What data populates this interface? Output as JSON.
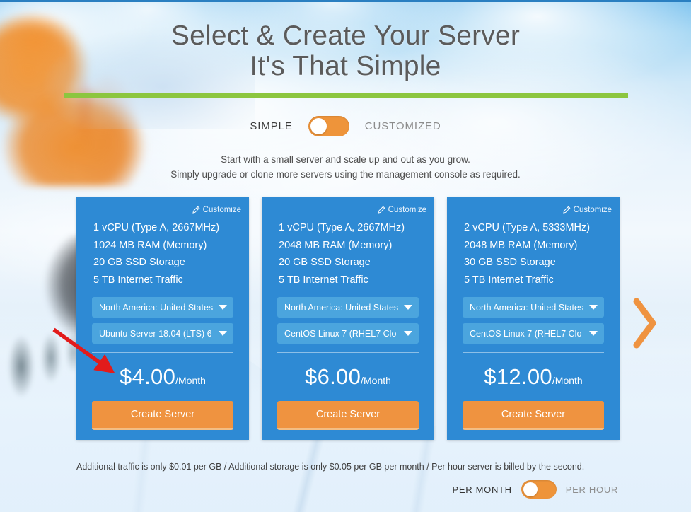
{
  "page": {
    "headline_line1": "Select & Create Your Server",
    "headline_line2": "It's That Simple",
    "subcopy_line1": "Start with a small server and scale up and out as you grow.",
    "subcopy_line2": "Simply upgrade or clone more servers using the management console as required.",
    "footnote": "Additional traffic is only $0.01 per GB / Additional storage is only $0.05 per GB per month / Per hour server is billed by the second.",
    "accent_green": "#8cc63f",
    "accent_orange": "#ef9340",
    "card_blue": "#2e8ad4",
    "select_blue": "#4ba5de",
    "annotation_red": "#e21b1b"
  },
  "mode_toggle": {
    "left_label": "SIMPLE",
    "right_label": "CUSTOMIZED",
    "selected": "SIMPLE",
    "knob_position": "left"
  },
  "billing_toggle": {
    "left_label": "PER MONTH",
    "right_label": "PER HOUR",
    "selected": "PER MONTH",
    "knob_position": "left"
  },
  "nav": {
    "next_label": "next",
    "next_icon": "chevron-right-icon"
  },
  "cards": [
    {
      "customize_label": "Customize",
      "customize_icon": "pencil-icon",
      "specs": [
        "1 vCPU (Type A, 2667MHz)",
        "1024 MB RAM (Memory)",
        "20 GB SSD Storage",
        "5 TB Internet Traffic"
      ],
      "region_select": "North America: United States",
      "os_select": "Ubuntu Server 18.04 (LTS) 6",
      "price_amount": "$4.00",
      "price_period": "/Month",
      "cta_label": "Create Server"
    },
    {
      "customize_label": "Customize",
      "customize_icon": "pencil-icon",
      "specs": [
        "1 vCPU (Type A, 2667MHz)",
        "2048 MB RAM (Memory)",
        "20 GB SSD Storage",
        "5 TB Internet Traffic"
      ],
      "region_select": "North America: United States",
      "os_select": "CentOS Linux 7 (RHEL7 Clo",
      "price_amount": "$6.00",
      "price_period": "/Month",
      "cta_label": "Create Server"
    },
    {
      "customize_label": "Customize",
      "customize_icon": "pencil-icon",
      "specs": [
        "2 vCPU (Type A, 5333MHz)",
        "2048 MB RAM (Memory)",
        "30 GB SSD Storage",
        "5 TB Internet Traffic"
      ],
      "region_select": "North America: United States",
      "os_select": "CentOS Linux 7 (RHEL7 Clo",
      "price_amount": "$12.00",
      "price_period": "/Month",
      "cta_label": "Create Server"
    }
  ]
}
